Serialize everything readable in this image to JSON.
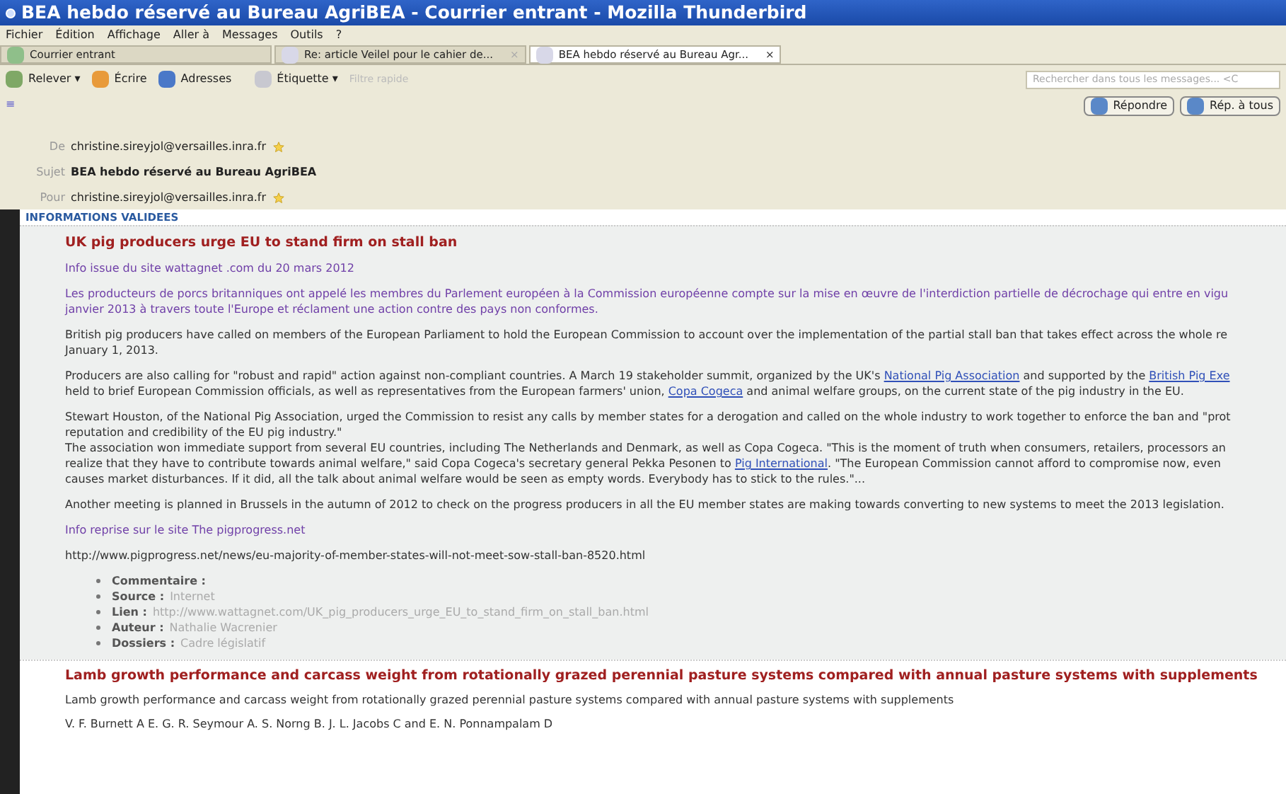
{
  "window": {
    "title": "BEA hebdo réservé au Bureau AgriBEA - Courrier entrant - Mozilla Thunderbird"
  },
  "menu": [
    "Fichier",
    "Édition",
    "Affichage",
    "Aller à",
    "Messages",
    "Outils",
    "?"
  ],
  "tabs": [
    {
      "label": "Courrier entrant",
      "selected": false
    },
    {
      "label": "Re: article Veilel pour le cahier de...",
      "selected": false,
      "close": "×"
    },
    {
      "label": "BEA hebdo réservé au Bureau Agr...",
      "selected": true,
      "close": "×"
    }
  ],
  "toolbar": {
    "get": "Relever",
    "get_caret": "▾",
    "write": "Écrire",
    "addresses": "Adresses",
    "tag": "Étiquette",
    "tag_caret": "▾",
    "filter_placeholder": "Filtre rapide",
    "search_placeholder": "Rechercher dans tous les messages... <C"
  },
  "header": {
    "menu_icon": "≡",
    "fields": [
      {
        "label": "De",
        "value": "christine.sireyjol@versailles.inra.fr",
        "starred": true
      },
      {
        "label": "Sujet",
        "value": "BEA hebdo réservé au Bureau AgriBEA",
        "starred": false
      },
      {
        "label": "Pour",
        "value": "christine.sireyjol@versailles.inra.fr",
        "starred": true
      }
    ],
    "buttons": [
      "Répondre",
      "Rép. à tous"
    ]
  },
  "body": {
    "section": "INFORMATIONS VALIDEES",
    "article": {
      "title": "UK pig producers urge EU to stand firm on stall ban",
      "blocks": [
        {
          "kind": "source",
          "lines": [
            [
              {
                "text": "Info issue du site wattagnet .com du 20 mars 2012",
                "link": false
              }
            ]
          ]
        },
        {
          "kind": "french",
          "lines": [
            [
              {
                "text": "Les producteurs de porcs britanniques ont appelé les membres du Parlement européen à la Commission européenne compte sur la mise en œuvre de l'interdiction partielle de décrochage qui entre en vigu",
                "link": false
              }
            ],
            [
              {
                "text": "janvier 2013 à travers toute l'Europe et réclament une action contre des pays non conformes.",
                "link": false
              }
            ]
          ]
        },
        {
          "kind": "text",
          "lines": [
            [
              {
                "text": "British pig producers have called on members of the European Parliament to hold the European Commission to account over the implementation of the partial stall ban that takes effect across the whole re",
                "link": false
              }
            ],
            [
              {
                "text": "January 1, 2013.",
                "link": false
              }
            ]
          ]
        },
        {
          "kind": "text",
          "lines": [
            [
              {
                "text": "Producers are also calling for \"robust and rapid\" action against non-compliant countries. A March 19 stakeholder summit, organized by the UK's ",
                "link": false
              },
              {
                "text": "National Pig Association",
                "link": true
              },
              {
                "text": " and supported by the ",
                "link": false
              },
              {
                "text": "British Pig Exe",
                "link": true
              }
            ],
            [
              {
                "text": "held to brief European Commission officials, as well as representatives from the European farmers' union, ",
                "link": false
              },
              {
                "text": "Copa Cogeca",
                "link": true
              },
              {
                "text": " and animal welfare groups, on the current state of the pig industry in the EU.",
                "link": false
              }
            ]
          ]
        },
        {
          "kind": "text",
          "lines": [
            [
              {
                "text": "Stewart Houston, of the National Pig Association, urged the Commission to resist any calls by member states for a derogation and called on the whole industry to work together to enforce the ban and \"prot",
                "link": false
              }
            ],
            [
              {
                "text": "reputation and credibility of the EU pig industry.\"",
                "link": false
              }
            ],
            [
              {
                "text": "The association won immediate support from several EU countries, including The Netherlands and Denmark, as well as Copa Cogeca. \"This is the moment of truth when consumers, retailers, processors an",
                "link": false
              }
            ],
            [
              {
                "text": "realize that they have to contribute towards animal welfare,\" said Copa Cogeca's secretary general Pekka Pesonen to ",
                "link": false
              },
              {
                "text": "Pig International",
                "link": true
              },
              {
                "text": ". \"The European Commission cannot afford to compromise now, even",
                "link": false
              }
            ],
            [
              {
                "text": "causes market disturbances. If it did, all the talk about animal welfare would be seen as empty words. Everybody has to stick to the rules.\"...",
                "link": false
              }
            ]
          ]
        },
        {
          "kind": "text",
          "lines": [
            [
              {
                "text": "Another meeting is planned in Brussels in the autumn of 2012 to check on the progress producers in all the EU member states are making towards converting to new systems to meet the 2013 legislation.",
                "link": false
              }
            ]
          ]
        },
        {
          "kind": "source",
          "lines": [
            [
              {
                "text": "Info reprise sur le site The pigprogress.net",
                "link": false
              }
            ]
          ]
        },
        {
          "kind": "text",
          "lines": [
            [
              {
                "text": "http://www.pigprogress.net/news/eu-majority-of-member-states-will-not-meet-sow-stall-ban-8520.html",
                "link": false
              }
            ]
          ]
        }
      ],
      "details": [
        {
          "label": "Commentaire :"
        },
        {
          "label": "Source :",
          "value": "Internet"
        },
        {
          "label": "Lien :",
          "value": "http://www.wattagnet.com/UK_pig_producers_urge_EU_to_stand_firm_on_stall_ban.html"
        },
        {
          "label": "Auteur :",
          "value": "Nathalie Wacrenier"
        },
        {
          "label": "Dossiers :",
          "value": "Cadre législatif"
        }
      ]
    },
    "article2": {
      "title": "Lamb growth performance and carcass weight from rotationally grazed perennial pasture systems compared with annual pasture systems with supplements",
      "lines": [
        "Lamb growth performance and carcass weight from rotationally grazed perennial pasture systems compared with annual pasture systems with supplements",
        "V. F. Burnett A E. G. R. Seymour A. S. Norng B. J. L. Jacobs C and E. N. Ponnampalam D"
      ]
    }
  }
}
